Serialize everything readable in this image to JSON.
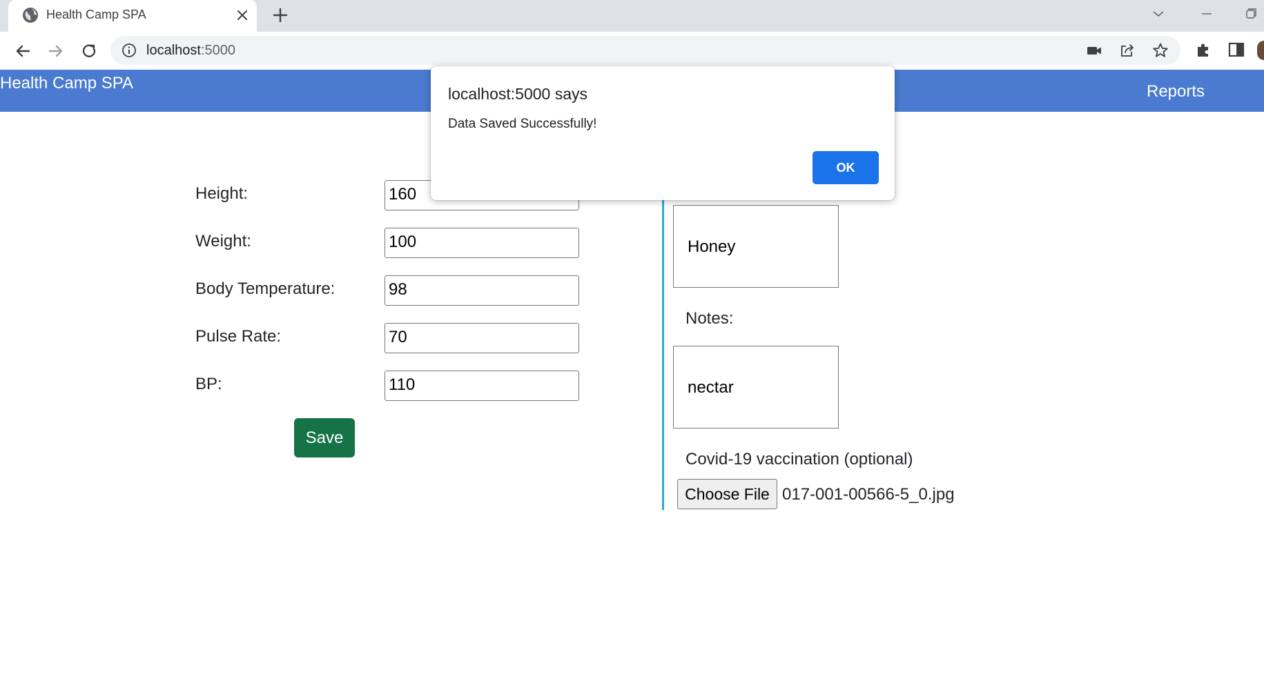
{
  "browser": {
    "tab_title": "Health Camp SPA",
    "url_host": "localhost",
    "url_port": ":5000"
  },
  "app": {
    "brand": "Health Camp SPA",
    "nav_partial": "s",
    "nav_reports": "Reports"
  },
  "form": {
    "height_label": "Height:",
    "height_value": "160",
    "weight_label": "Weight:",
    "weight_value": "100",
    "temp_label": "Body Temperature:",
    "temp_value": "98",
    "pulse_label": "Pulse Rate:",
    "pulse_value": "70",
    "bp_label": "BP:",
    "bp_value": "110",
    "save_label": "Save"
  },
  "right_panel": {
    "box1_value": "Honey",
    "notes_label": "Notes:",
    "notes_value": "nectar",
    "covid_label": "Covid-19 vaccination (optional)",
    "choose_file_label": "Choose File",
    "file_name": "017-001-00566-5_0.jpg"
  },
  "dialog": {
    "title": "localhost:5000 says",
    "message": "Data Saved Successfully!",
    "ok_label": "OK"
  },
  "colors": {
    "nav_bar": "#4a7bd0",
    "save_button": "#157347",
    "divider": "#2ea8d6",
    "dialog_ok": "#1a73e8"
  },
  "icons": [
    "globe-favicon-icon",
    "close-icon",
    "plus-icon",
    "chevron-down-icon",
    "minimize-icon",
    "restore-icon",
    "back-arrow-icon",
    "forward-arrow-icon",
    "reload-icon",
    "info-icon",
    "camera-icon",
    "share-icon",
    "star-icon",
    "extensions-icon",
    "side-panel-icon",
    "avatar"
  ]
}
